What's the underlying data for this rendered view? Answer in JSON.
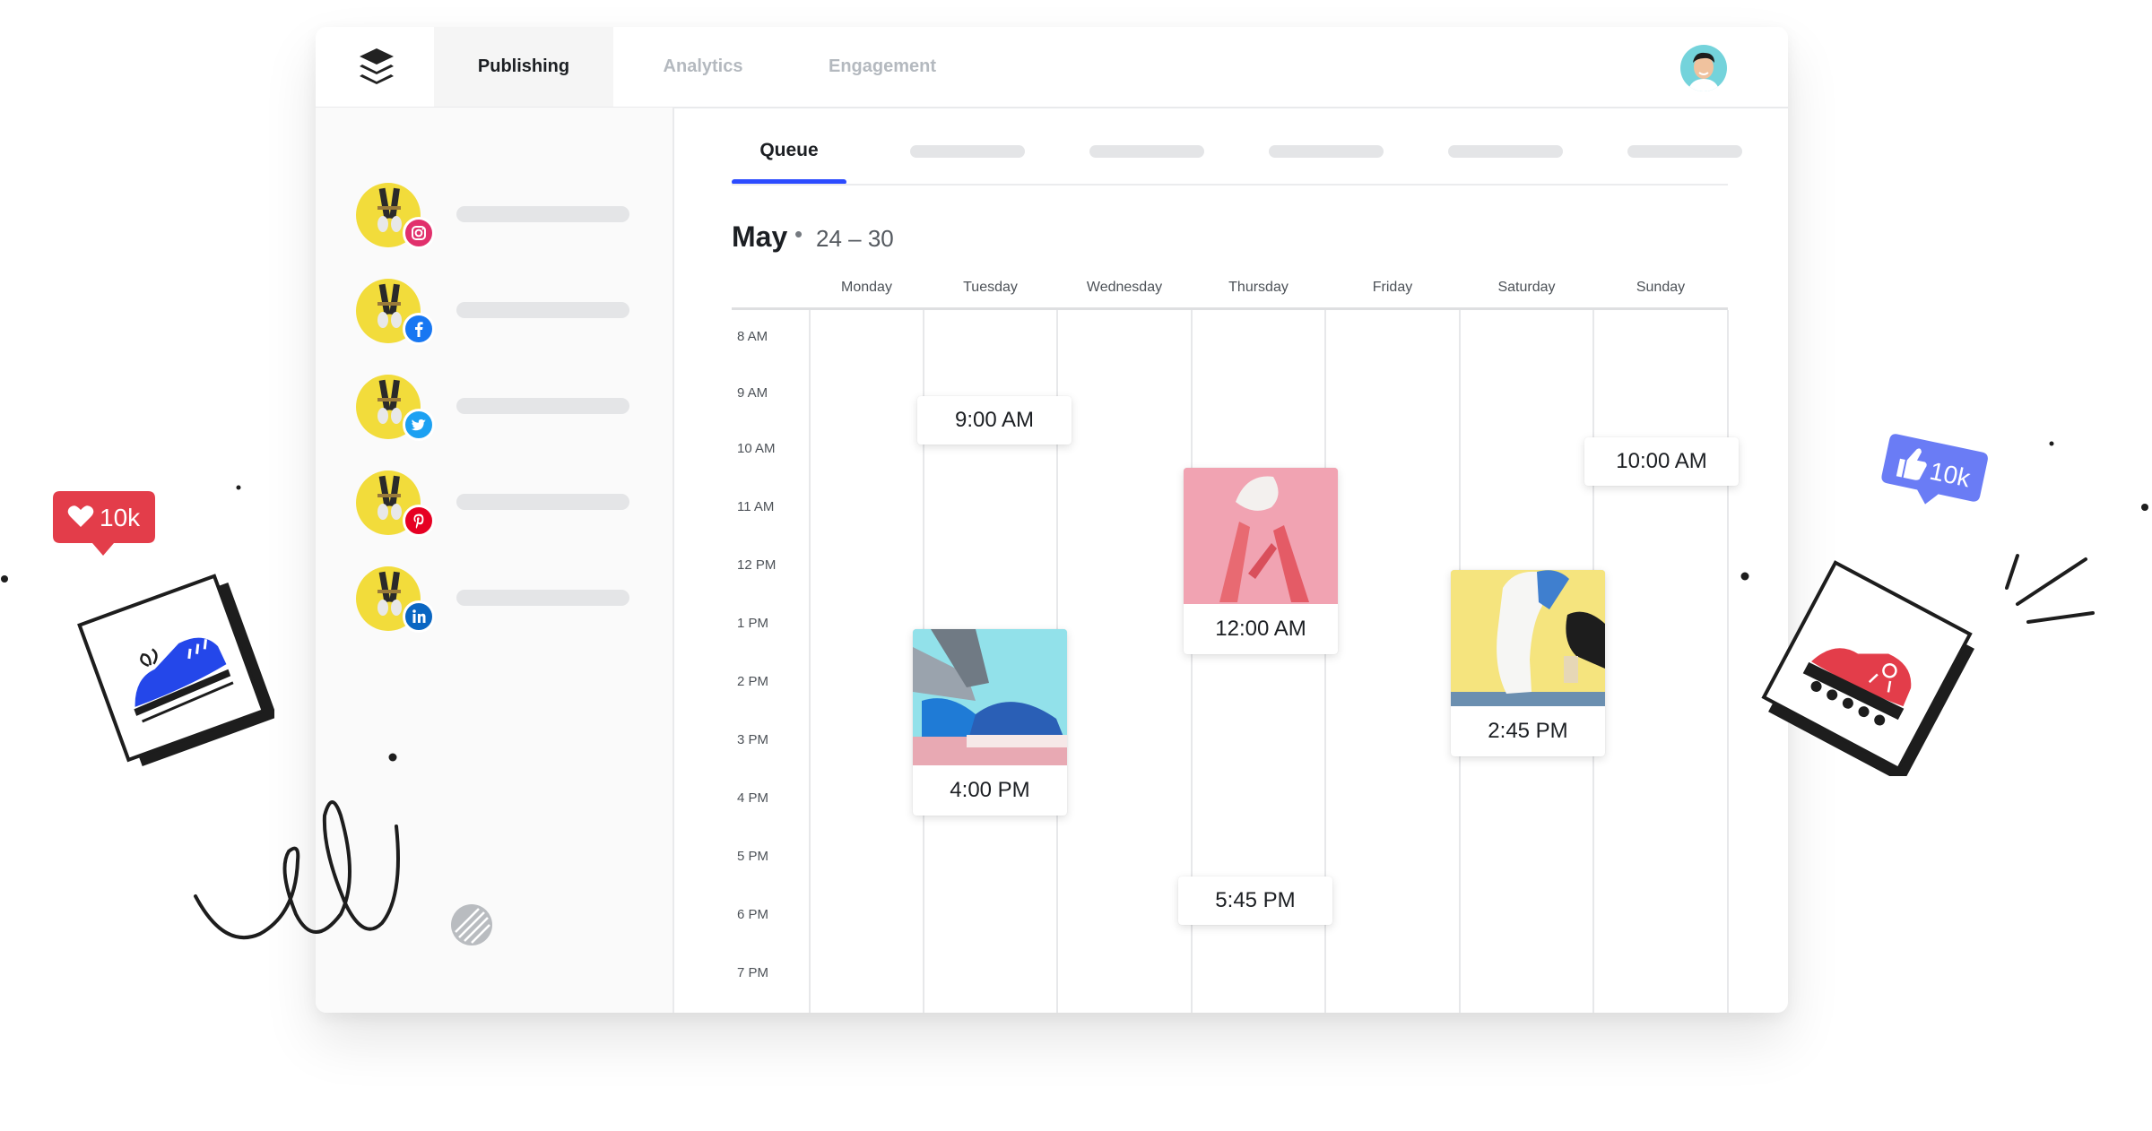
{
  "nav": {
    "tabs": [
      {
        "label": "Publishing",
        "active": true
      },
      {
        "label": "Analytics",
        "active": false
      },
      {
        "label": "Engagement",
        "active": false
      }
    ]
  },
  "sidebar": {
    "profiles": [
      {
        "network": "instagram",
        "icon": "instagram-icon",
        "color": "#e1306c"
      },
      {
        "network": "facebook",
        "icon": "facebook-icon",
        "color": "#1877f2"
      },
      {
        "network": "twitter",
        "icon": "twitter-icon",
        "color": "#1da1f2"
      },
      {
        "network": "pinterest",
        "icon": "pinterest-icon",
        "color": "#e60023"
      },
      {
        "network": "linkedin",
        "icon": "linkedin-icon",
        "color": "#0a66c2"
      }
    ]
  },
  "subtabs": {
    "active_label": "Queue"
  },
  "calendar": {
    "month": "May",
    "separator": "•",
    "range": "24 – 30",
    "days": [
      "Monday",
      "Tuesday",
      "Wednesday",
      "Thursday",
      "Friday",
      "Saturday",
      "Sunday"
    ],
    "hours": [
      "8 AM",
      "9 AM",
      "10 AM",
      "11 AM",
      "12 PM",
      "1 PM",
      "2 PM",
      "3 PM",
      "4 PM",
      "5 PM",
      "6 PM",
      "7 PM"
    ],
    "posts": [
      {
        "day": "Tuesday",
        "time": "9:00 AM",
        "has_image": false
      },
      {
        "day": "Tuesday",
        "time": "4:00 PM",
        "has_image": true
      },
      {
        "day": "Thursday",
        "time": "12:00 AM",
        "has_image": true
      },
      {
        "day": "Thursday",
        "time": "5:45 PM",
        "has_image": false
      },
      {
        "day": "Saturday",
        "time": "2:45 PM",
        "has_image": true
      },
      {
        "day": "Sunday",
        "time": "10:00 AM",
        "has_image": false
      }
    ]
  },
  "decorations": {
    "left_like_badge": "10k",
    "right_like_badge": "10k",
    "colors": {
      "accent": "#2c4bff",
      "heart_badge": "#e33d4a",
      "thumb_badge": "#6a7cf5"
    }
  }
}
